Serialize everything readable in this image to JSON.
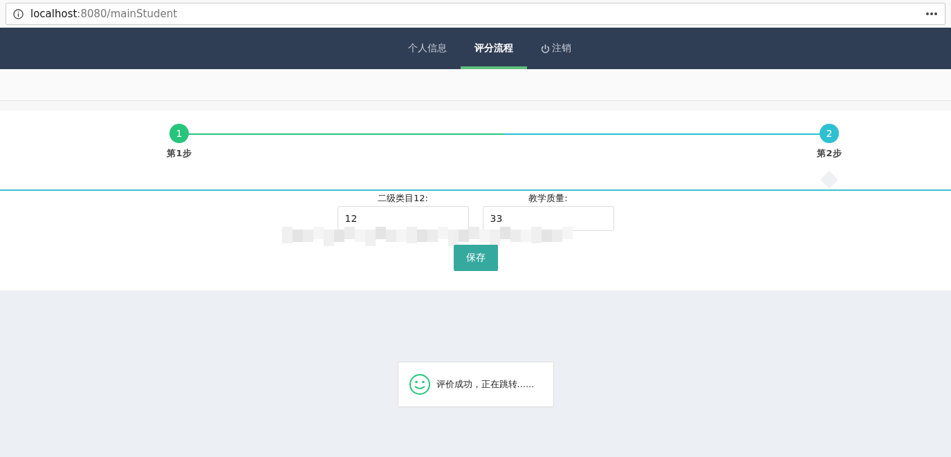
{
  "browser": {
    "url": "**localhost**:8080/mainStudent"
  },
  "nav": {
    "items": [
      {
        "label": "个人信息",
        "kind": "text",
        "selected": false
      },
      {
        "label": "评分流程",
        "kind": "text",
        "selected": true
      },
      {
        "label": "注销",
        "kind": "power",
        "selected": false
      }
    ]
  },
  "steps": [
    {
      "number": "1",
      "label": "第1步",
      "done": true
    },
    {
      "number": "2",
      "label": "第2步",
      "done": false
    }
  ],
  "form": {
    "fields": [
      {
        "label": "二级类目12:",
        "value": "12"
      },
      {
        "label": "教学质量:",
        "value": "33"
      }
    ],
    "save_button": "保存"
  },
  "toast": {
    "message": "评价成功，正在跳转......"
  }
}
